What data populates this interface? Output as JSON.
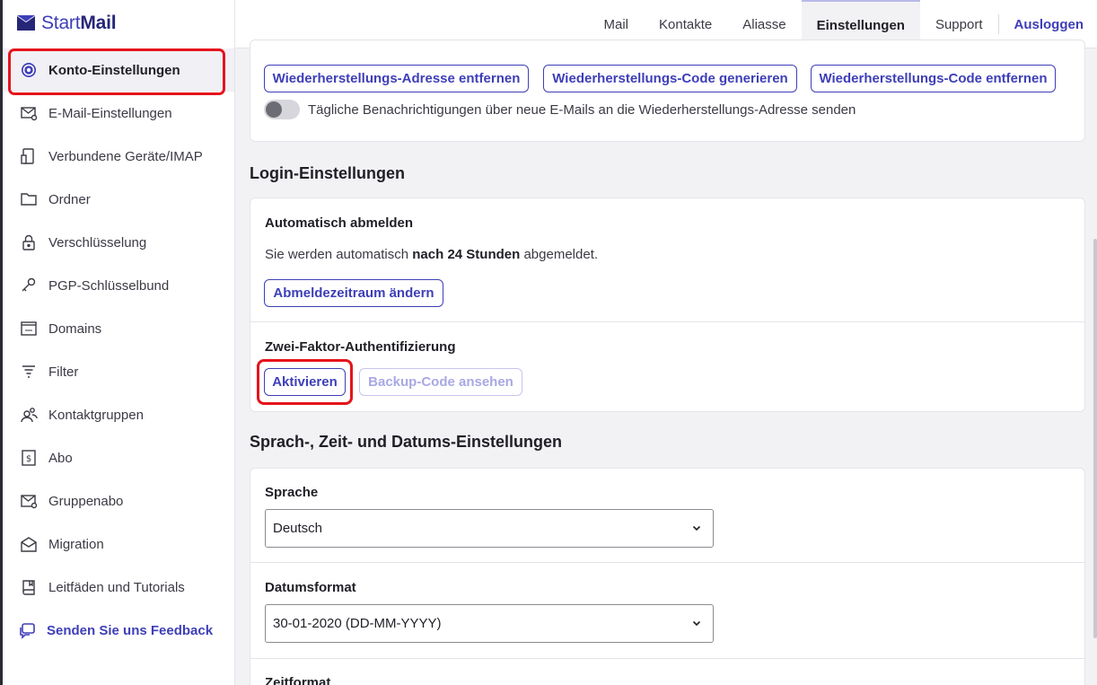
{
  "brand": {
    "start": "Start",
    "mail": "Mail"
  },
  "topnav": {
    "items": [
      "Mail",
      "Kontakte",
      "Aliasse",
      "Einstellungen",
      "Support"
    ],
    "active": "Einstellungen",
    "logout": "Ausloggen"
  },
  "sidebar": {
    "items": [
      {
        "label": "Konto-Einstellungen",
        "icon": "gear-icon",
        "active": true
      },
      {
        "label": "E-Mail-Einstellungen",
        "icon": "mail-settings-icon"
      },
      {
        "label": "Verbundene Geräte/IMAP",
        "icon": "devices-icon"
      },
      {
        "label": "Ordner",
        "icon": "folder-icon"
      },
      {
        "label": "Verschlüsselung",
        "icon": "lock-icon"
      },
      {
        "label": "PGP-Schlüsselbund",
        "icon": "key-icon"
      },
      {
        "label": "Domains",
        "icon": "domain-icon"
      },
      {
        "label": "Filter",
        "icon": "filter-icon"
      },
      {
        "label": "Kontaktgruppen",
        "icon": "contact-group-icon"
      },
      {
        "label": "Abo",
        "icon": "subscription-icon"
      },
      {
        "label": "Gruppenabo",
        "icon": "group-subscription-icon"
      },
      {
        "label": "Migration",
        "icon": "migration-icon"
      },
      {
        "label": "Leitfäden und Tutorials",
        "icon": "book-icon"
      }
    ],
    "feedback": "Senden Sie uns Feedback"
  },
  "recovery": {
    "remove_address": "Wiederherstellungs-Adresse entfernen",
    "generate_code": "Wiederherstellungs-Code generieren",
    "remove_code": "Wiederherstellungs-Code entfernen",
    "daily_notifications": "Tägliche Benachrichtigungen über neue E-Mails an die Wiederherstellungs-Adresse senden",
    "daily_notifications_enabled": false
  },
  "login": {
    "title": "Login-Einstellungen",
    "auto_logout_title": "Automatisch abmelden",
    "auto_logout_prefix": "Sie werden automatisch ",
    "auto_logout_value": "nach 24 Stunden",
    "auto_logout_suffix": " abgemeldet.",
    "change_period": "Abmeldezeitraum ändern",
    "twofa_title": "Zwei-Faktor-Authentifizierung",
    "activate": "Aktivieren",
    "backup_code": "Backup-Code ansehen"
  },
  "locale": {
    "title": "Sprach-, Zeit- und Datums-Einstellungen",
    "language_label": "Sprache",
    "language_value": "Deutsch",
    "date_format_label": "Datumsformat",
    "date_format_value": "30-01-2020 (DD-MM-YYYY)",
    "time_format_label": "Zeitformat"
  },
  "colors": {
    "accent": "#3e3eb8",
    "highlight": "#e5141c"
  }
}
